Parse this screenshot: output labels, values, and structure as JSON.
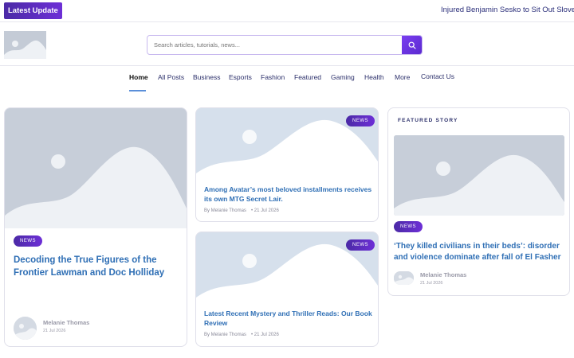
{
  "topbar": {
    "latest_label": "Latest  Update",
    "ticker_text": "Injured Benjamin Sesko to Sit Out Slovenia Ma"
  },
  "search": {
    "placeholder": "Search articles, tutorials, news...",
    "icon": "search-icon"
  },
  "nav": {
    "items": [
      {
        "label": "Home"
      },
      {
        "label": "All Posts"
      },
      {
        "label": "Business"
      },
      {
        "label": "Esports"
      },
      {
        "label": "Fashion"
      },
      {
        "label": "Featured"
      },
      {
        "label": "Gaming"
      },
      {
        "label": "Health"
      },
      {
        "label": "More"
      },
      {
        "label": "Contact Us"
      }
    ]
  },
  "cards": {
    "main": {
      "badge": "NEWS",
      "title": "Decoding the True Figures of the Frontier Lawman and Doc Holliday",
      "author": "Melanie Thomas",
      "date": "21 Jul 2026"
    },
    "mid1": {
      "badge": "NEWS",
      "title": "Among Avatar’s most beloved installments receives its own MTG Secret Lair.",
      "byline": "By Melanie Thomas",
      "date": "• 21 Jul 2026"
    },
    "mid2": {
      "badge": "NEWS",
      "title": "Latest Recent Mystery and Thriller Reads: Our Book Review",
      "byline": "By Melanie Thomas",
      "date": "• 21 Jul 2026"
    },
    "featured": {
      "label": "FEATURED STORY",
      "badge": "NEWS",
      "title": "‘They killed civilians in their beds’: disorder and violence dominate after fall of El Fasher",
      "author": "Melanie Thomas",
      "date": "21 Jul 2026"
    }
  },
  "colors": {
    "accent": "#5b2ad0",
    "title_blue": "#2f6fb5",
    "nav_text": "#2b2f6a"
  }
}
